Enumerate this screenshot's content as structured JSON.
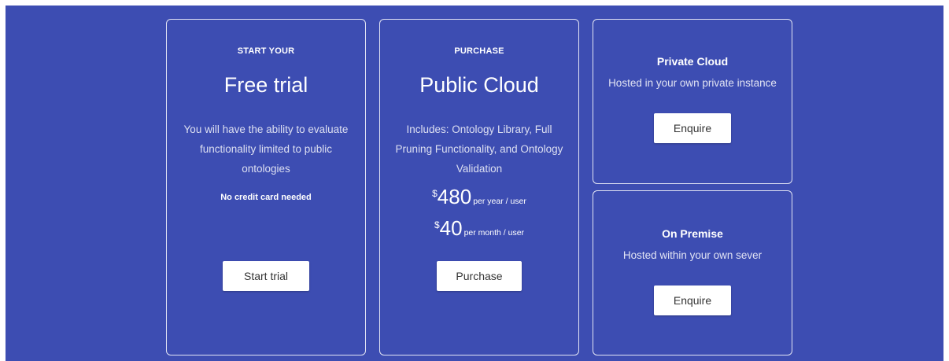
{
  "free_trial": {
    "kicker": "START YOUR",
    "title": "Free trial",
    "description_lines": [
      "You will have the ability to evaluate",
      "functionality limited to public",
      "ontologies"
    ],
    "note": "No credit card needed",
    "button_label": "Start trial"
  },
  "public_cloud": {
    "kicker": "PURCHASE",
    "title": "Public Cloud",
    "description_lines": [
      "Includes: Ontology Library, Full",
      "Pruning Functionality, and Ontology",
      "Validation"
    ],
    "prices": [
      {
        "currency": "$",
        "amount": "480",
        "period": "per year / user"
      },
      {
        "currency": "$",
        "amount": "40",
        "period": "per month / user"
      }
    ],
    "button_label": "Purchase"
  },
  "private_cloud": {
    "title": "Private Cloud",
    "description": "Hosted in your own private instance",
    "button_label": "Enquire"
  },
  "on_premise": {
    "title": "On Premise",
    "description": "Hosted within your own sever",
    "button_label": "Enquire"
  },
  "colors": {
    "background": "#3d4db2",
    "button": "#ffffff",
    "button_text": "#333333"
  }
}
